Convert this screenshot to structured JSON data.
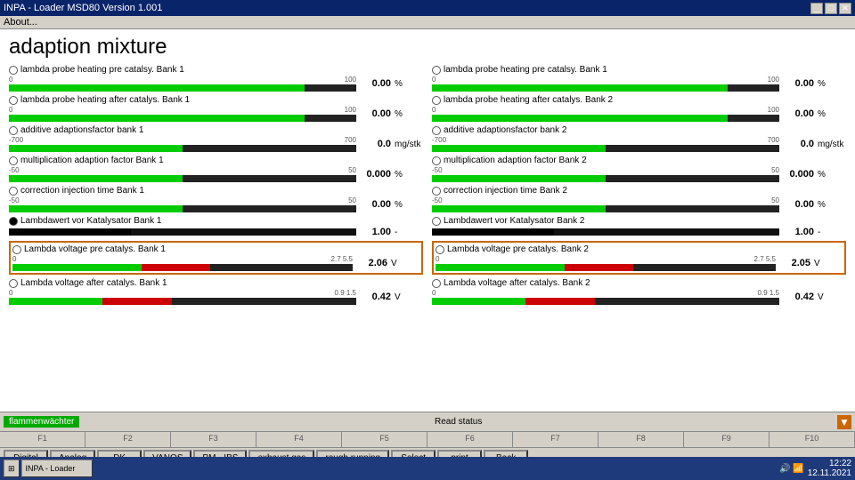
{
  "titleBar": {
    "title": "INPA - Loader  MSD80 Version 1.001",
    "controls": [
      "_",
      "□",
      "✕"
    ]
  },
  "menuBar": {
    "items": [
      "About..."
    ]
  },
  "pageTitle": "adaption mixture",
  "leftColumn": [
    {
      "id": "row1-left",
      "label": "lambda probe heating pre catalsy. Bank 1",
      "hasRadio": true,
      "radioFilled": false,
      "scaleMin": "0",
      "scaleMax": "100",
      "greenWidth": "85%",
      "redWidth": "0%",
      "redLeft": "0%",
      "value": "0.00",
      "unit": "%",
      "highlight": false
    },
    {
      "id": "row2-left",
      "label": "lambda probe heating after catalys. Bank 1",
      "hasRadio": true,
      "radioFilled": false,
      "scaleMin": "0",
      "scaleMax": "100",
      "greenWidth": "85%",
      "redWidth": "0%",
      "redLeft": "0%",
      "value": "0.00",
      "unit": "%",
      "highlight": false
    },
    {
      "id": "row3-left",
      "label": "additive adaptionsfactor bank 1",
      "hasRadio": true,
      "radioFilled": false,
      "scaleMin": "-700",
      "scaleMax": "700",
      "greenWidth": "50%",
      "redWidth": "0%",
      "redLeft": "0%",
      "value": "0.0",
      "unit": "mg/stk",
      "highlight": false
    },
    {
      "id": "row4-left",
      "label": "multiplication adaption factor Bank 1",
      "hasRadio": true,
      "radioFilled": false,
      "scaleMin": "-50",
      "scaleMax": "50",
      "greenWidth": "50%",
      "redWidth": "0%",
      "redLeft": "0%",
      "value": "0.000",
      "unit": "%",
      "highlight": false
    },
    {
      "id": "row5-left",
      "label": "correction injection time Bank 1",
      "hasRadio": true,
      "radioFilled": false,
      "scaleMin": "-50",
      "scaleMax": "50",
      "greenWidth": "50%",
      "redWidth": "0%",
      "redLeft": "0%",
      "value": "0.00",
      "unit": "%",
      "highlight": false
    },
    {
      "id": "row6-left",
      "label": "Lambdawert vor Katalysator Bank 1",
      "hasRadio": true,
      "radioFilled": true,
      "scaleMin": "",
      "scaleMax": "",
      "greenWidth": "0%",
      "blackWidth": "30%",
      "redWidth": "0%",
      "redLeft": "0%",
      "value": "1.00",
      "unit": "-",
      "highlight": false,
      "isBlack": true
    },
    {
      "id": "row7-left",
      "label": "Lambda voltage pre catalys. Bank 1",
      "hasRadio": true,
      "radioFilled": false,
      "scaleMin": "0",
      "scaleMax": "2.7",
      "scaleMax2": "5.5",
      "greenWidth": "38%",
      "redWidth": "20%",
      "redLeft": "38%",
      "value": "2.06",
      "unit": "V",
      "highlight": true
    },
    {
      "id": "row8-left",
      "label": "Lambda voltage after catalys. Bank 1",
      "hasRadio": true,
      "radioFilled": false,
      "scaleMin": "0",
      "scaleMax": "0.9",
      "scaleMax2": "1.5",
      "greenWidth": "27%",
      "redWidth": "20%",
      "redLeft": "27%",
      "value": "0.42",
      "unit": "V",
      "highlight": false
    }
  ],
  "rightColumn": [
    {
      "id": "row1-right",
      "label": "lambda probe heating pre catalsy. Bank 1",
      "hasRadio": true,
      "radioFilled": false,
      "scaleMin": "0",
      "scaleMax": "100",
      "greenWidth": "85%",
      "redWidth": "0%",
      "redLeft": "0%",
      "value": "0.00",
      "unit": "%",
      "highlight": false
    },
    {
      "id": "row2-right",
      "label": "lambda probe heating after catalys. Bank 2",
      "hasRadio": true,
      "radioFilled": false,
      "scaleMin": "0",
      "scaleMax": "100",
      "greenWidth": "85%",
      "redWidth": "0%",
      "redLeft": "0%",
      "value": "0.00",
      "unit": "%",
      "highlight": false
    },
    {
      "id": "row3-right",
      "label": "additive adaptionsfactor bank 2",
      "hasRadio": true,
      "radioFilled": false,
      "scaleMin": "-700",
      "scaleMax": "700",
      "greenWidth": "50%",
      "redWidth": "0%",
      "redLeft": "0%",
      "value": "0.0",
      "unit": "mg/stk",
      "highlight": false
    },
    {
      "id": "row4-right",
      "label": "multiplication adaption factor Bank 2",
      "hasRadio": true,
      "radioFilled": false,
      "scaleMin": "-50",
      "scaleMax": "50",
      "greenWidth": "50%",
      "redWidth": "0%",
      "redLeft": "0%",
      "value": "0.000",
      "unit": "%",
      "highlight": false
    },
    {
      "id": "row5-right",
      "label": "correction injection time Bank 2",
      "hasRadio": true,
      "radioFilled": false,
      "scaleMin": "-50",
      "scaleMax": "50",
      "greenWidth": "50%",
      "redWidth": "0%",
      "redLeft": "0%",
      "value": "0.00",
      "unit": "%",
      "highlight": false
    },
    {
      "id": "row6-right",
      "label": "Lambdawert vor Katalysator Bank 2",
      "hasRadio": true,
      "radioFilled": false,
      "scaleMin": "",
      "scaleMax": "",
      "greenWidth": "0%",
      "blackWidth": "30%",
      "redWidth": "0%",
      "redLeft": "0%",
      "value": "1.00",
      "unit": "-",
      "highlight": false,
      "isBlack": true
    },
    {
      "id": "row7-right",
      "label": "Lambda voltage pre catalys. Bank 2",
      "hasRadio": true,
      "radioFilled": false,
      "scaleMin": "0",
      "scaleMax": "2.7",
      "scaleMax2": "5.5",
      "greenWidth": "38%",
      "redWidth": "20%",
      "redLeft": "38%",
      "value": "2.05",
      "unit": "V",
      "highlight": true
    },
    {
      "id": "row8-right",
      "label": "Lambda voltage after catalys. Bank 2",
      "hasRadio": true,
      "radioFilled": false,
      "scaleMin": "0",
      "scaleMax": "0.9",
      "scaleMax2": "1.5",
      "greenWidth": "27%",
      "redWidth": "20%",
      "redLeft": "27%",
      "value": "0.42",
      "unit": "V",
      "highlight": false
    }
  ],
  "statusBar": {
    "leftLabel": "flammenwächter",
    "centerLabel": "Read status",
    "arrowIcon": "▼"
  },
  "functionKeys": [
    "F1",
    "F2",
    "F3",
    "F4",
    "F5",
    "F6",
    "F7",
    "F8",
    "F9",
    "F10"
  ],
  "buttons": [
    {
      "id": "btn-digital",
      "label": "Digital"
    },
    {
      "id": "btn-analog",
      "label": "Analog"
    },
    {
      "id": "btn-dk",
      "label": "DK"
    },
    {
      "id": "btn-vanos",
      "label": "VANOS"
    },
    {
      "id": "btn-pm-ibs",
      "label": "PM · IBS"
    },
    {
      "id": "btn-exhaust",
      "label": "exhaust gas"
    },
    {
      "id": "btn-rough",
      "label": "rough running"
    },
    {
      "id": "btn-select",
      "label": "Select"
    },
    {
      "id": "btn-print",
      "label": "print"
    },
    {
      "id": "btn-back",
      "label": "Back"
    }
  ],
  "taskbar": {
    "startIcon": "⊞",
    "clock": "12:22",
    "date": "12.11.2021"
  }
}
